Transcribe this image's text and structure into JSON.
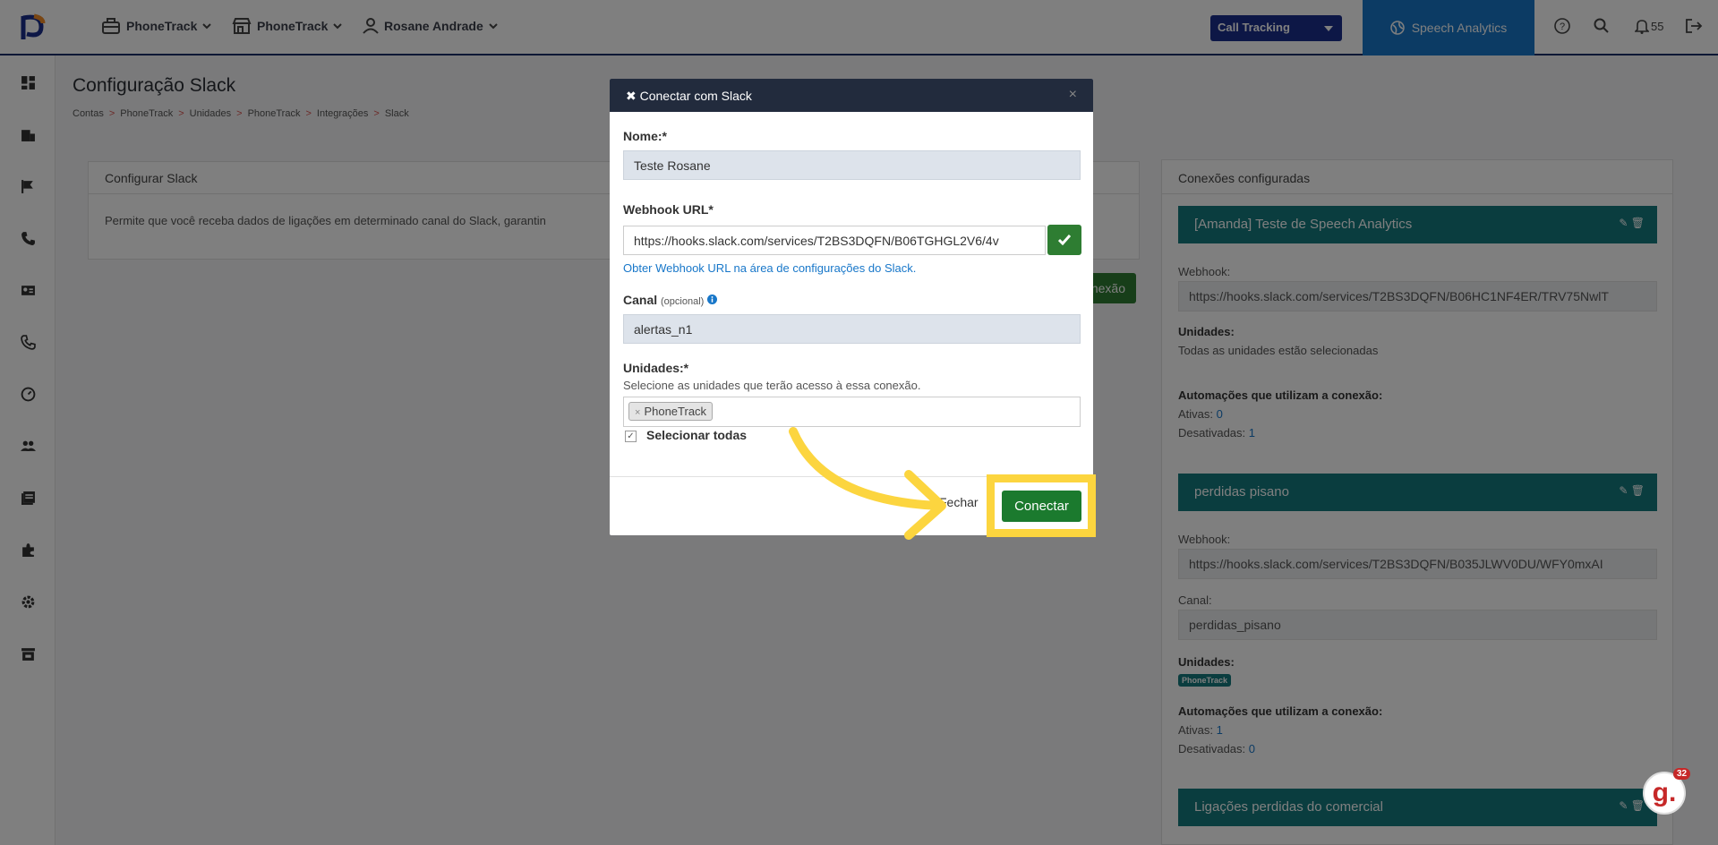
{
  "topbar": {
    "account": "PhoneTrack",
    "unit": "PhoneTrack",
    "user": "Rosane Andrade",
    "product_select": "Call Tracking",
    "speech_analytics": "Speech Analytics",
    "notifications_count": "55"
  },
  "page": {
    "title": "Configuração Slack",
    "breadcrumb": [
      "Contas",
      "PhoneTrack",
      "Unidades",
      "PhoneTrack",
      "Integrações",
      "Slack"
    ],
    "breadcrumb_sep": ">"
  },
  "configure_card": {
    "title": "Configurar Slack",
    "description": "Permite que você receba dados de ligações em determinado canal do Slack, garantin",
    "new_button_fragment": "nexão"
  },
  "connections": {
    "title": "Conexões configuradas",
    "webhook_label": "Webhook:",
    "units_label": "Unidades:",
    "channel_label": "Canal:",
    "automations_label": "Automações que utilizam a conexão:",
    "active_label": "Ativas:",
    "disabled_label": "Desativadas:",
    "items": [
      {
        "name": "[Amanda] Teste de Speech Analytics",
        "webhook": "https://hooks.slack.com/services/T2BS3DQFN/B06HC1NF4ER/TRV75NwlT",
        "units_text": "Todas as unidades estão selecionadas",
        "active": "0",
        "disabled": "1"
      },
      {
        "name": "perdidas pisano",
        "webhook": "https://hooks.slack.com/services/T2BS3DQFN/B035JLWV0DU/WFY0mxAI",
        "channel": "perdidas_pisano",
        "unit_tag": "PhoneTrack",
        "active": "1",
        "disabled": "0"
      },
      {
        "name": "Ligações perdidas do comercial"
      }
    ]
  },
  "modal": {
    "title": "Conectar com Slack",
    "name_label": "Nome:*",
    "name_value": "Teste Rosane",
    "webhook_label": "Webhook URL*",
    "webhook_value": "https://hooks.slack.com/services/T2BS3DQFN/B06TGHGL2V6/4v",
    "webhook_help_link": "Obter Webhook URL na área de configurações do Slack.",
    "channel_label": "Canal",
    "channel_optional": "(opcional)",
    "channel_value": "alertas_n1",
    "units_label": "Unidades:*",
    "units_help": "Selecione as unidades que terão acesso à essa conexão.",
    "units_selected": "PhoneTrack",
    "select_all_label": "Selecionar todas",
    "close_button": "Fechar",
    "connect_button": "Conectar"
  },
  "support_widget": {
    "count": "32"
  },
  "colors": {
    "primary_dark": "#1b2f8c",
    "speech_blue": "#1877c9",
    "teal": "#157a7e",
    "green": "#2e7d32",
    "highlight_yellow": "#fcd53f"
  }
}
